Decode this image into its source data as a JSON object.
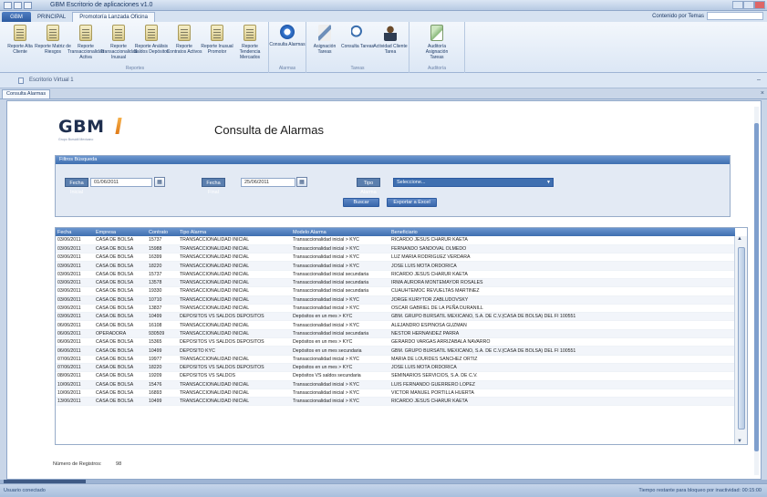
{
  "app": {
    "title": "GBM Escritorio de aplicaciones v1.0",
    "menu_button": "GBM",
    "tabs": [
      "PRINCIPAL",
      "Promotoría Lanzada Oficina"
    ],
    "help_search_label": "Contenido por Temas"
  },
  "ribbon": {
    "groups": [
      {
        "label": "Reportes",
        "buttons": [
          {
            "label": "Reporte Alta Cliente",
            "icon": "document-icon"
          },
          {
            "label": "Reporte Matriz de Riesgos",
            "icon": "document-icon"
          },
          {
            "label": "Reporte Transaccionalidad Activa",
            "icon": "document-icon"
          },
          {
            "label": "Reporte Transaccionalidad Inusual",
            "icon": "document-icon"
          },
          {
            "label": "Reporte Análisis Saldos Depósitos",
            "icon": "document-icon"
          },
          {
            "label": "Reporte Contratos Activos",
            "icon": "document-icon"
          },
          {
            "label": "Reporte Inusual Promotor",
            "icon": "document-icon"
          },
          {
            "label": "Reporte Tendencia Mercados",
            "icon": "document-icon"
          }
        ]
      },
      {
        "label": "Alarmas",
        "buttons": [
          {
            "label": "Consulta Alarmas",
            "icon": "alarm-icon"
          }
        ]
      },
      {
        "label": "Tareas",
        "buttons": [
          {
            "label": "Asignación Tareas",
            "icon": "tools-icon"
          },
          {
            "label": "Consulta Tareas",
            "icon": "search-icon"
          },
          {
            "label": "Actividad Cliente Tarea",
            "icon": "person-icon"
          }
        ]
      },
      {
        "label": "Auditoría",
        "buttons": [
          {
            "label": "Auditoría Asignación Tareas",
            "icon": "audit-icon"
          }
        ]
      }
    ]
  },
  "document": {
    "name": "Escritorio Virtual 1",
    "tab": "Consulta Alarmas"
  },
  "page": {
    "logo_text": "GBM",
    "logo_sub": "Grupo Bursátil Mexicano",
    "title": "Consulta de Alarmas"
  },
  "filters": {
    "header": "Filtros Búsqueda",
    "fecha_inicial_label": "Fecha Inicial",
    "fecha_inicial_value": "01/06/2011",
    "fecha_final_label": "Fecha Final",
    "fecha_final_value": "25/06/2011",
    "tipo_alarma_label": "Tipo Alarma",
    "tipo_alarma_value": "Seleccione...",
    "buscar_label": "Buscar",
    "exportar_label": "Exportar a Excel"
  },
  "grid": {
    "columns": [
      "Fecha",
      "Empresa",
      "Contrato",
      "Tipo Alarma",
      "Modelo Alarma",
      "Beneficiario"
    ],
    "rows": [
      [
        "03/06/2011",
        "CASA DE BOLSA",
        "15737",
        "TRANSACCIONALIDAD INICIAL",
        "Transaccionalidad inicial > KYC",
        "RICARDO JESUS CHARUR KAETA"
      ],
      [
        "03/06/2011",
        "CASA DE BOLSA",
        "15988",
        "TRANSACCIONALIDAD INICIAL",
        "Transaccionalidad inicial > KYC",
        "FERNANDO SANDOVAL OLMEDO"
      ],
      [
        "03/06/2011",
        "CASA DE BOLSA",
        "16399",
        "TRANSACCIONALIDAD INICIAL",
        "Transaccionalidad inicial > KYC",
        "LUZ MARIA RODRIGUEZ VERDARA"
      ],
      [
        "03/06/2011",
        "CASA DE BOLSA",
        "18220",
        "TRANSACCIONALIDAD INICIAL",
        "Transaccionalidad inicial > KYC",
        "JOSE LUIS MOTA ORDORICA"
      ],
      [
        "03/06/2011",
        "CASA DE BOLSA",
        "15737",
        "TRANSACCIONALIDAD INICIAL",
        "Transaccionalidad inicial secundaria",
        "RICARDO JESUS CHARUR KAETA"
      ],
      [
        "03/06/2011",
        "CASA DE BOLSA",
        "13578",
        "TRANSACCIONALIDAD INICIAL",
        "Transaccionalidad inicial secundaria",
        "IRMA AURORA MONTEMAYOR ROSALES"
      ],
      [
        "03/06/2011",
        "CASA DE BOLSA",
        "19330",
        "TRANSACCIONALIDAD INICIAL",
        "Transaccionalidad inicial secundaria",
        "CUAUHTEMOC REVUELTAS MARTINEZ"
      ],
      [
        "03/06/2011",
        "CASA DE BOLSA",
        "10710",
        "TRANSACCIONALIDAD INICIAL",
        "Transaccionalidad inicial > KYC",
        "JORGE KURYTOR ZABLUDOVSKY"
      ],
      [
        "03/06/2011",
        "CASA DE BOLSA",
        "13837",
        "TRANSACCIONALIDAD INICIAL",
        "Transaccionalidad inicial > KYC",
        "OSCAR GABRIEL DE LA PEÑA DURANILL"
      ],
      [
        "03/06/2011",
        "CASA DE BOLSA",
        "10499",
        "DEPOSITOS VS SALDOS DEPOSITOS",
        "Depósitos en un mes > KYC",
        "GBM. GRUPO BURSATIL MEXICANO, S.A. DE C.V.(CASA DE BOLSA) DEL FI 100551"
      ],
      [
        "06/06/2011",
        "CASA DE BOLSA",
        "16108",
        "TRANSACCIONALIDAD INICIAL",
        "Transaccionalidad inicial > KYC",
        "ALEJANDRO ESPINOSA GUZMAN"
      ],
      [
        "06/06/2011",
        "OPERADORA",
        "930509",
        "TRANSACCIONALIDAD INICIAL",
        "Transaccionalidad inicial secundaria",
        "NESTOR HERNANDEZ PARRA"
      ],
      [
        "06/06/2011",
        "CASA DE BOLSA",
        "15365",
        "DEPOSITOS VS SALDOS DEPOSITOS",
        "Depósitos en un mes > KYC",
        "GERARDO VARGAS ARRIZABALA NAVARRO"
      ],
      [
        "06/06/2011",
        "CASA DE BOLSA",
        "10499",
        "DEPOSITO KYC",
        "Depósitos en un mes secundaria",
        "GBM. GRUPO BURSATIL MEXICANO, S.A. DE C.V.(CASA DE BOLSA) DEL FI 100551"
      ],
      [
        "07/06/2011",
        "CASA DE BOLSA",
        "19977",
        "TRANSACCIONALIDAD INICIAL",
        "Transaccionalidad inicial > KYC",
        "MARIA DE LOURDES SANCHEZ ORTIZ"
      ],
      [
        "07/06/2011",
        "CASA DE BOLSA",
        "18220",
        "DEPOSITOS VS SALDOS DEPOSITOS",
        "Depósitos en un mes > KYC",
        "JOSE LUIS MOTA ORDORICA"
      ],
      [
        "08/06/2011",
        "CASA DE BOLSA",
        "19209",
        "DEPOSITOS VS SALDOS",
        "Depósitos VS saldos secundaria",
        "SEMINARIOS SERVICIOS, S.A. DE C.V."
      ],
      [
        "10/06/2011",
        "CASA DE BOLSA",
        "15476",
        "TRANSACCIONALIDAD INICIAL",
        "Transaccionalidad inicial > KYC",
        "LUIS FERNANDO GUERRERO LOPEZ"
      ],
      [
        "10/06/2011",
        "CASA DE BOLSA",
        "16893",
        "TRANSACCIONALIDAD INICIAL",
        "Transaccionalidad inicial > KYC",
        "VICTOR MANUEL PORTILLA HUERTA"
      ],
      [
        "13/06/2011",
        "CASA DE BOLSA",
        "10499",
        "TRANSACCIONALIDAD INICIAL",
        "Transaccionalidad inicial > KYC",
        "RICARDO JESUS CHARUR KAETA"
      ]
    ]
  },
  "footer": {
    "total_label": "Número de Registros:",
    "total_value": "98"
  },
  "statusbar": {
    "left": "Usuario conectado",
    "right": "Tiempo restante para bloqueo por inactividad: 00:15:00"
  }
}
